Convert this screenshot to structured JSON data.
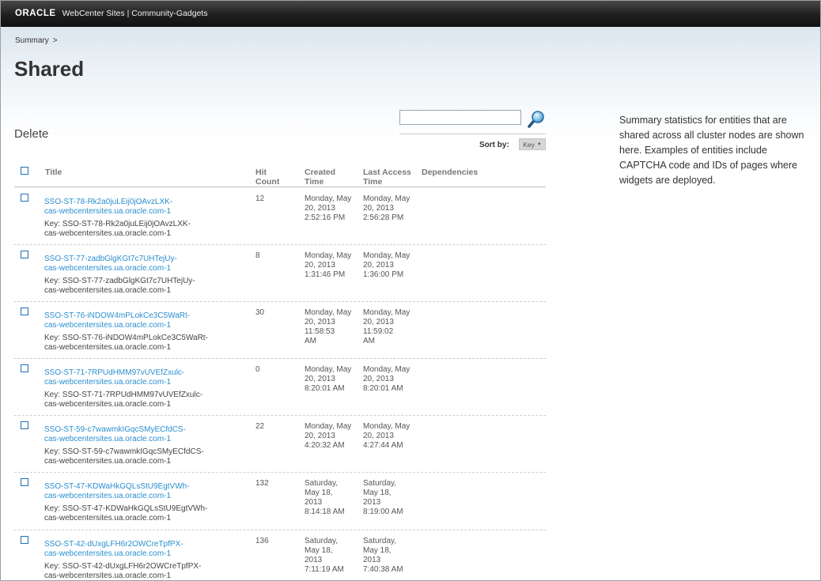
{
  "header": {
    "brand": "ORACLE",
    "app_title": "WebCenter Sites | Community-Gadgets"
  },
  "breadcrumb": {
    "item": "Summary",
    "sep": ">"
  },
  "page_title": "Shared",
  "delete_label": "Delete",
  "search": {
    "value": "",
    "placeholder": ""
  },
  "sort": {
    "label": "Sort by:",
    "value": "Key"
  },
  "columns": {
    "title": "Title",
    "hit": [
      "Hit",
      "Count"
    ],
    "created": [
      "Created",
      "Time"
    ],
    "last": [
      "Last Access",
      "Time"
    ],
    "deps": "Dependencies"
  },
  "rows": [
    {
      "title": [
        "SSO-ST-78-Rk2a0juLEij0jOAvzLXK-",
        "cas-webcentersites.ua.oracle.com-1"
      ],
      "key": [
        "Key: SSO-ST-78-Rk2a0juLEij0jOAvzLXK-",
        "cas-webcentersites.ua.oracle.com-1"
      ],
      "hit": "12",
      "created": [
        "Monday, May",
        "20, 2013",
        "2:52:16 PM"
      ],
      "last": [
        "Monday, May",
        "20, 2013",
        "2:56:28 PM"
      ]
    },
    {
      "title": [
        "SSO-ST-77-zadbGlgKGt7c7UHTejUy-",
        "cas-webcentersites.ua.oracle.com-1"
      ],
      "key": [
        "Key: SSO-ST-77-zadbGlgKGt7c7UHTejUy-",
        "cas-webcentersites.ua.oracle.com-1"
      ],
      "hit": "8",
      "created": [
        "Monday, May",
        "20, 2013",
        "1:31:46 PM"
      ],
      "last": [
        "Monday, May",
        "20, 2013",
        "1:36:00 PM"
      ]
    },
    {
      "title": [
        "SSO-ST-76-iNDOW4mPLokCe3C5WaRt-",
        "cas-webcentersites.ua.oracle.com-1"
      ],
      "key": [
        "Key: SSO-ST-76-iNDOW4mPLokCe3C5WaRt-",
        "cas-webcentersites.ua.oracle.com-1"
      ],
      "hit": "30",
      "created": [
        "Monday, May",
        "20, 2013",
        "11:58:53",
        "AM"
      ],
      "last": [
        "Monday, May",
        "20, 2013",
        "11:59:02",
        "AM"
      ]
    },
    {
      "title": [
        "SSO-ST-71-7RPUdHMM97vUVEfZxulc-",
        "cas-webcentersites.ua.oracle.com-1"
      ],
      "key": [
        "Key: SSO-ST-71-7RPUdHMM97vUVEfZxulc-",
        "cas-webcentersites.ua.oracle.com-1"
      ],
      "hit": "0",
      "created": [
        "Monday, May",
        "20, 2013",
        "8:20:01 AM"
      ],
      "last": [
        "Monday, May",
        "20, 2013",
        "8:20:01 AM"
      ]
    },
    {
      "title": [
        "SSO-ST-59-c7wawmkIGqcSMyECfdCS-",
        "cas-webcentersites.ua.oracle.com-1"
      ],
      "key": [
        "Key: SSO-ST-59-c7wawmkIGqcSMyECfdCS-",
        "cas-webcentersites.ua.oracle.com-1"
      ],
      "hit": "22",
      "created": [
        "Monday, May",
        "20, 2013",
        "4:20:32 AM"
      ],
      "last": [
        "Monday, May",
        "20, 2013",
        "4:27:44 AM"
      ]
    },
    {
      "title": [
        "SSO-ST-47-KDWaHkGQLsStU9EgtVWh-",
        "cas-webcentersites.ua.oracle.com-1"
      ],
      "key": [
        "Key: SSO-ST-47-KDWaHkGQLsStU9EgtVWh-",
        "cas-webcentersites.ua.oracle.com-1"
      ],
      "hit": "132",
      "created": [
        "Saturday,",
        "May 18,",
        "2013",
        "8:14:18 AM"
      ],
      "last": [
        "Saturday,",
        "May 18,",
        "2013",
        "8:19:00 AM"
      ]
    },
    {
      "title": [
        "SSO-ST-42-dUxgLFH6r2OWCreTpfPX-",
        "cas-webcentersites.ua.oracle.com-1"
      ],
      "key": [
        "Key: SSO-ST-42-dUxgLFH6r2OWCreTpfPX-",
        "cas-webcentersites.ua.oracle.com-1"
      ],
      "hit": "136",
      "created": [
        "Saturday,",
        "May 18,",
        "2013",
        "7:11:19 AM"
      ],
      "last": [
        "Saturday,",
        "May 18,",
        "2013",
        "7:40:38 AM"
      ]
    }
  ],
  "info_lines": [
    "Summary statistics for entities that are",
    "shared across all cluster nodes are shown",
    "here. Examples of entities include",
    "CAPTCHA code and IDs of pages where",
    "widgets are deployed."
  ]
}
